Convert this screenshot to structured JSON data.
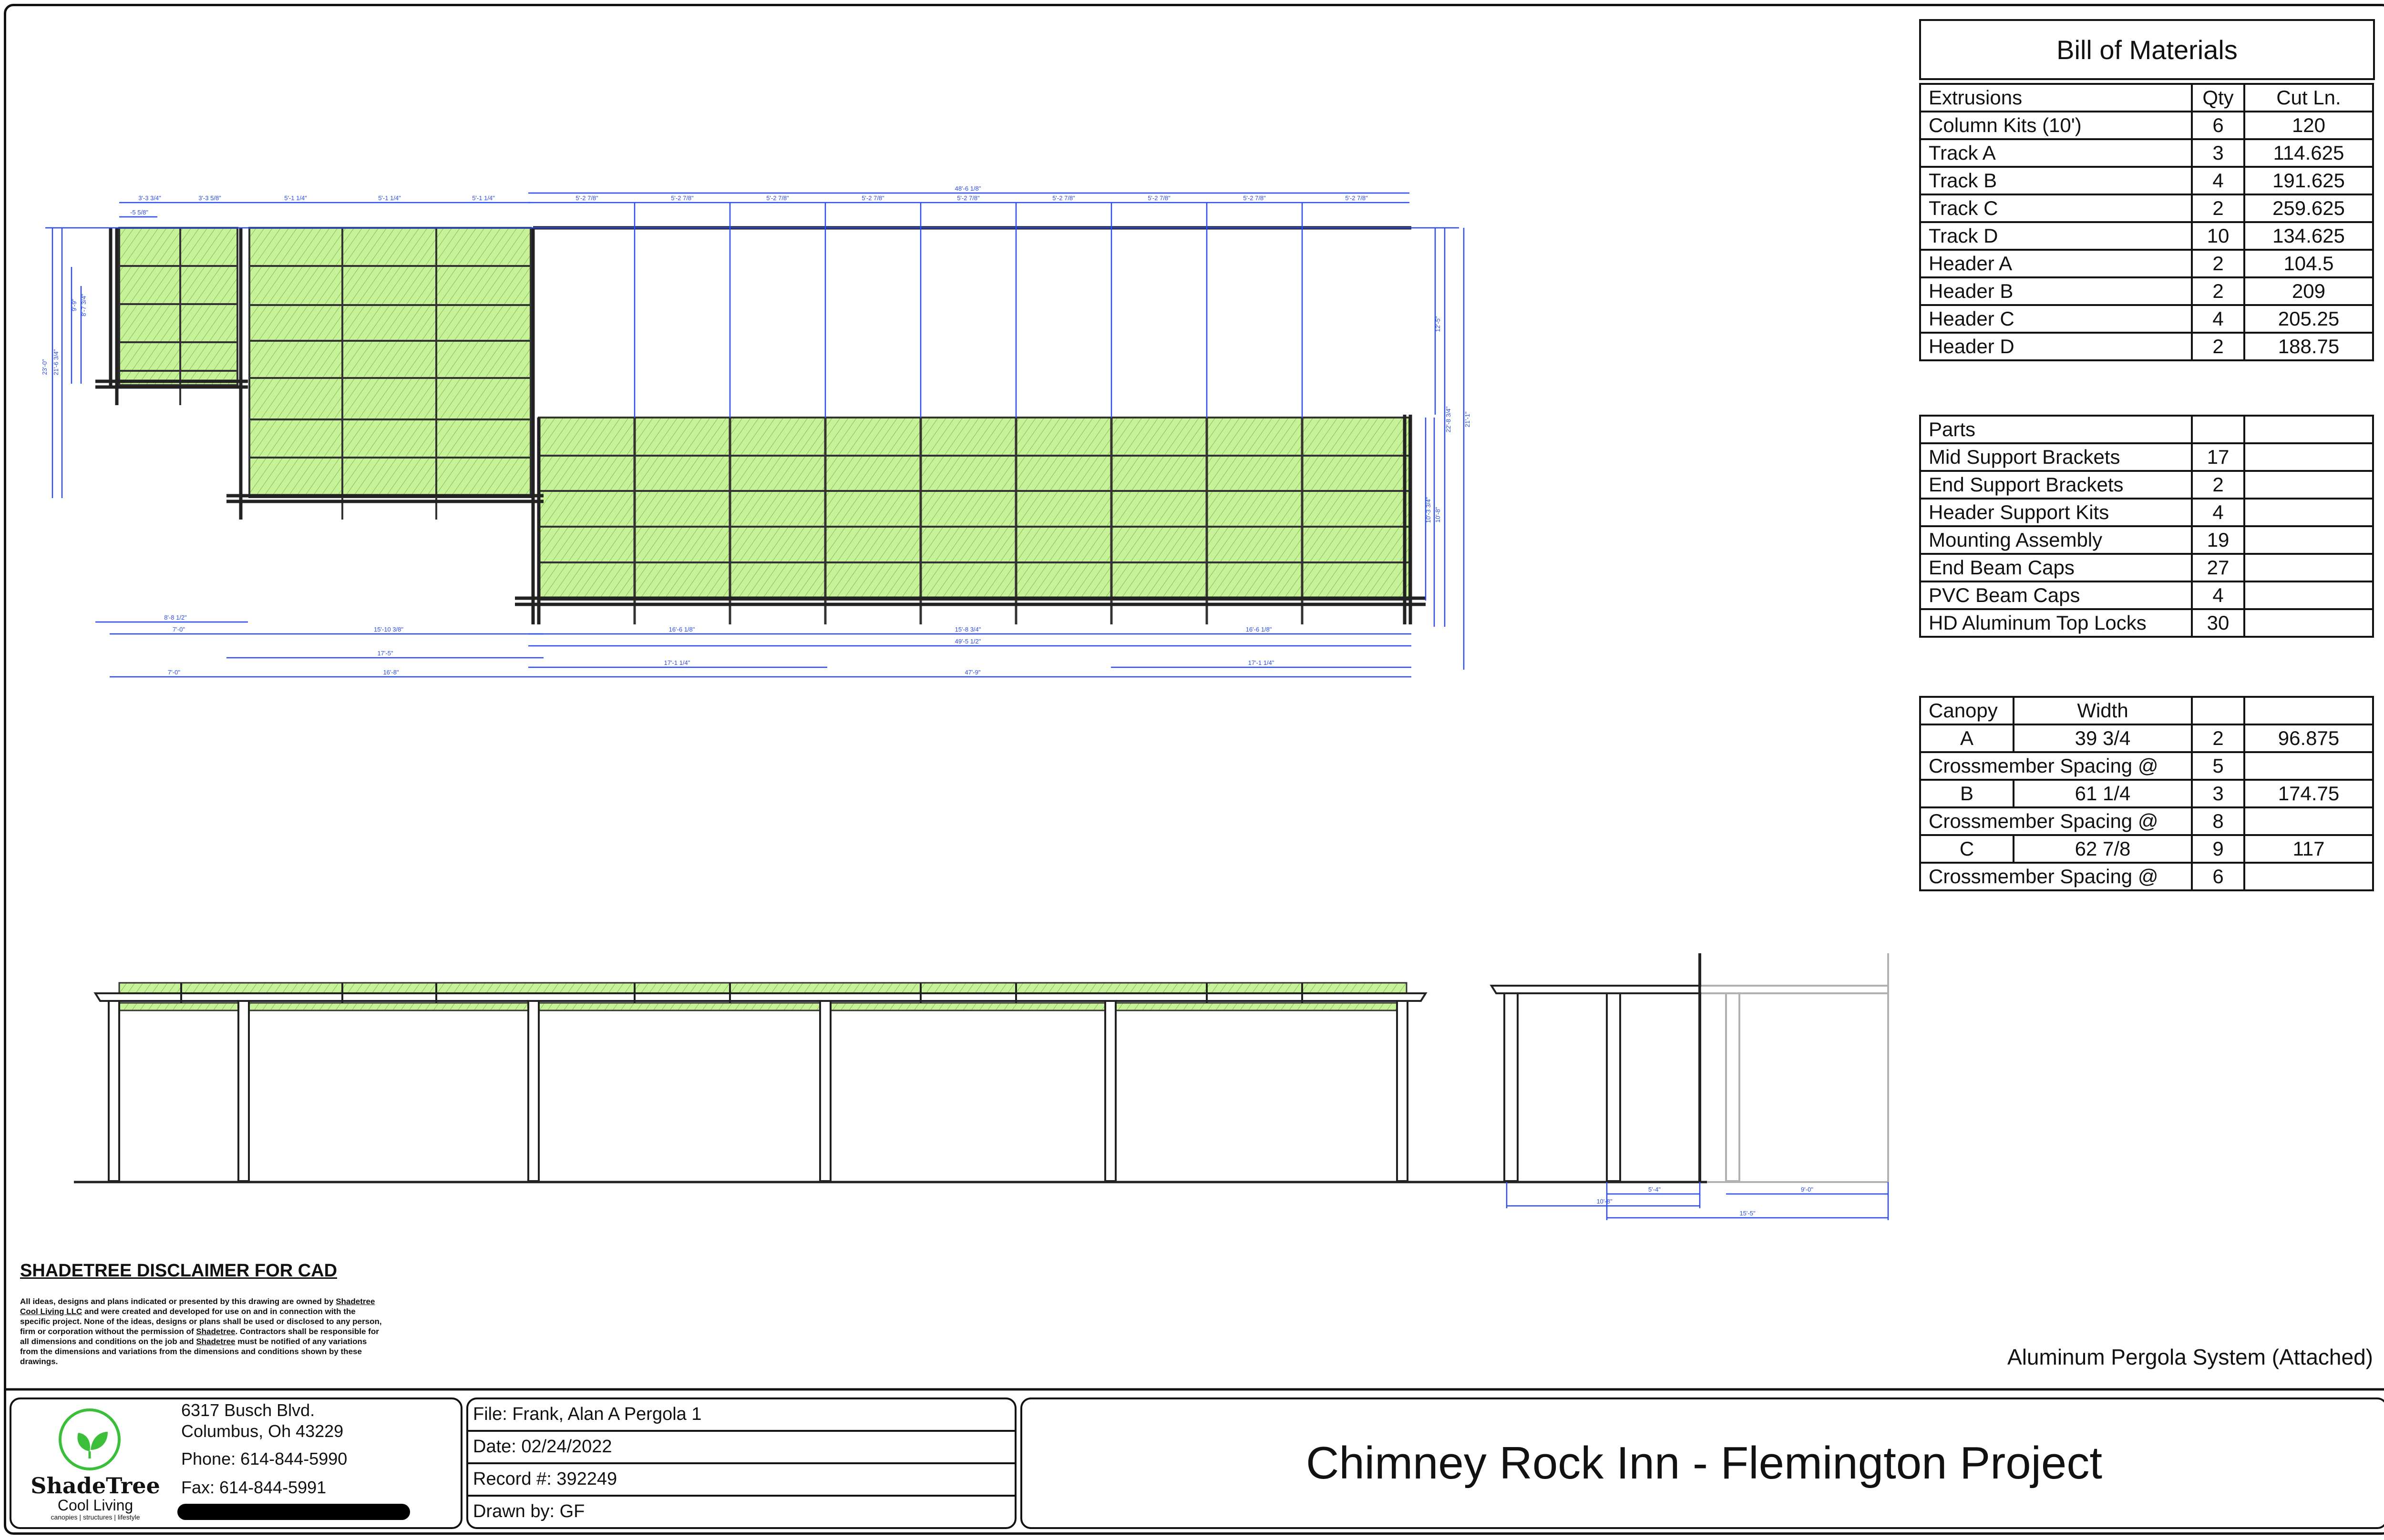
{
  "bom": {
    "title": "Bill of Materials",
    "extrusions": {
      "header": [
        "Extrusions",
        "Qty",
        "Cut Ln."
      ],
      "rows": [
        [
          "Column Kits (10')",
          "6",
          "120"
        ],
        [
          "Track A",
          "3",
          "114.625"
        ],
        [
          "Track B",
          "4",
          "191.625"
        ],
        [
          "Track C",
          "2",
          "259.625"
        ],
        [
          "Track D",
          "10",
          "134.625"
        ],
        [
          "Header A",
          "2",
          "104.5"
        ],
        [
          "Header B",
          "2",
          "209"
        ],
        [
          "Header C",
          "4",
          "205.25"
        ],
        [
          "Header D",
          "2",
          "188.75"
        ]
      ]
    },
    "parts": {
      "header": [
        "Parts",
        "",
        ""
      ],
      "rows": [
        [
          "Mid Support Brackets",
          "17",
          ""
        ],
        [
          "End Support Brackets",
          "2",
          ""
        ],
        [
          "Header Support Kits",
          "4",
          ""
        ],
        [
          "Mounting Assembly",
          "19",
          ""
        ],
        [
          "End Beam Caps",
          "27",
          ""
        ],
        [
          "PVC Beam Caps",
          "4",
          ""
        ],
        [
          "HD Aluminum Top Locks",
          "30",
          ""
        ]
      ]
    },
    "canopy": {
      "header": [
        "Canopy",
        "Width",
        "",
        ""
      ],
      "rows": [
        {
          "letter": "A",
          "width": "39 3/4",
          "qty": "2",
          "cut": "96.875"
        },
        {
          "label": "Crossmember Spacing @",
          "qty": "5"
        },
        {
          "letter": "B",
          "width": "61 1/4",
          "qty": "3",
          "cut": "174.75"
        },
        {
          "label": "Crossmember Spacing @",
          "qty": "8"
        },
        {
          "letter": "C",
          "width": "62 7/8",
          "qty": "9",
          "cut": "117"
        },
        {
          "label": "Crossmember Spacing @",
          "qty": "6"
        }
      ]
    }
  },
  "dimensions": {
    "top_a": [
      "3'-3 3/4\"",
      "3'-3 5/8\"",
      "5'-1 1/4\"",
      "5'-1 1/4\"",
      "5'-1 1/4\""
    ],
    "top_a_small": "-5 5/8\"",
    "top_c_total": "48'-6 1/8\"",
    "top_c_bay": "5'-2 7/8\"",
    "left_side": [
      "9'-9\"",
      "8'-7 3/4\"",
      "23'-0\"",
      "21'-6 3/4\""
    ],
    "right_side": [
      "12'-5\"",
      "22'-8 3/4\"",
      "21'-1\"",
      "10'-3 3/4\"",
      "10'-8\""
    ],
    "bottom_rows": [
      [
        "8'-8 1/2\""
      ],
      [
        "7'-0\"",
        "15'-10 3/8\"",
        "16'-6 1/8\"",
        "15'-8 3/4\"",
        "16'-6 1/8\""
      ],
      [
        "17'-5\"",
        "49'-5 1/2\""
      ],
      [
        "17'-1 1/4\"",
        "17'-1 1/4\""
      ],
      [
        "7'-0\"",
        "16'-8\"",
        "47'-9\""
      ]
    ],
    "side_view": [
      "5'-4\"",
      "10'-8\"",
      "9'-0\"",
      "15'-5\""
    ]
  },
  "disclaimer": {
    "title": "SHADETREE DISCLAIMER FOR CAD",
    "body_parts": [
      "All ideas, designs and plans indicated or presented by this drawing are owned by ",
      "Shadetree Cool Living LLC",
      " and were created and developed for use on and in connection with the specific project. None of the ideas, designs or plans shall be used or disclosed to any person, firm or corporation without the permission of ",
      "Shadetree",
      ". Contractors shall be responsible for all dimensions and conditions on the job and ",
      "Shadetree",
      " must be notified of any variations from the dimensions and variations from the dimensions and conditions shown by these drawings."
    ]
  },
  "subtitle": "Aluminum Pergola System (Attached)",
  "company": {
    "name": "ShadeTree",
    "tagline": "Cool Living",
    "small": "canopies | structures | lifestyle",
    "address1": "6317 Busch Blvd.",
    "address2": "Columbus, Oh 43229",
    "phone": "Phone: 614-844-5990",
    "fax": "Fax: 614-844-5991"
  },
  "info": {
    "file": "File: Frank, Alan A Pergola 1",
    "date": "Date: 02/24/2022",
    "record": "Record #: 392249",
    "drawn": "Drawn by: GF"
  },
  "project_title": "Chimney Rock Inn - Flemington Project",
  "colors": {
    "canopy_fill": "#c8f29a",
    "dimension_line": "#2a4cf0",
    "frame": "#222222"
  }
}
